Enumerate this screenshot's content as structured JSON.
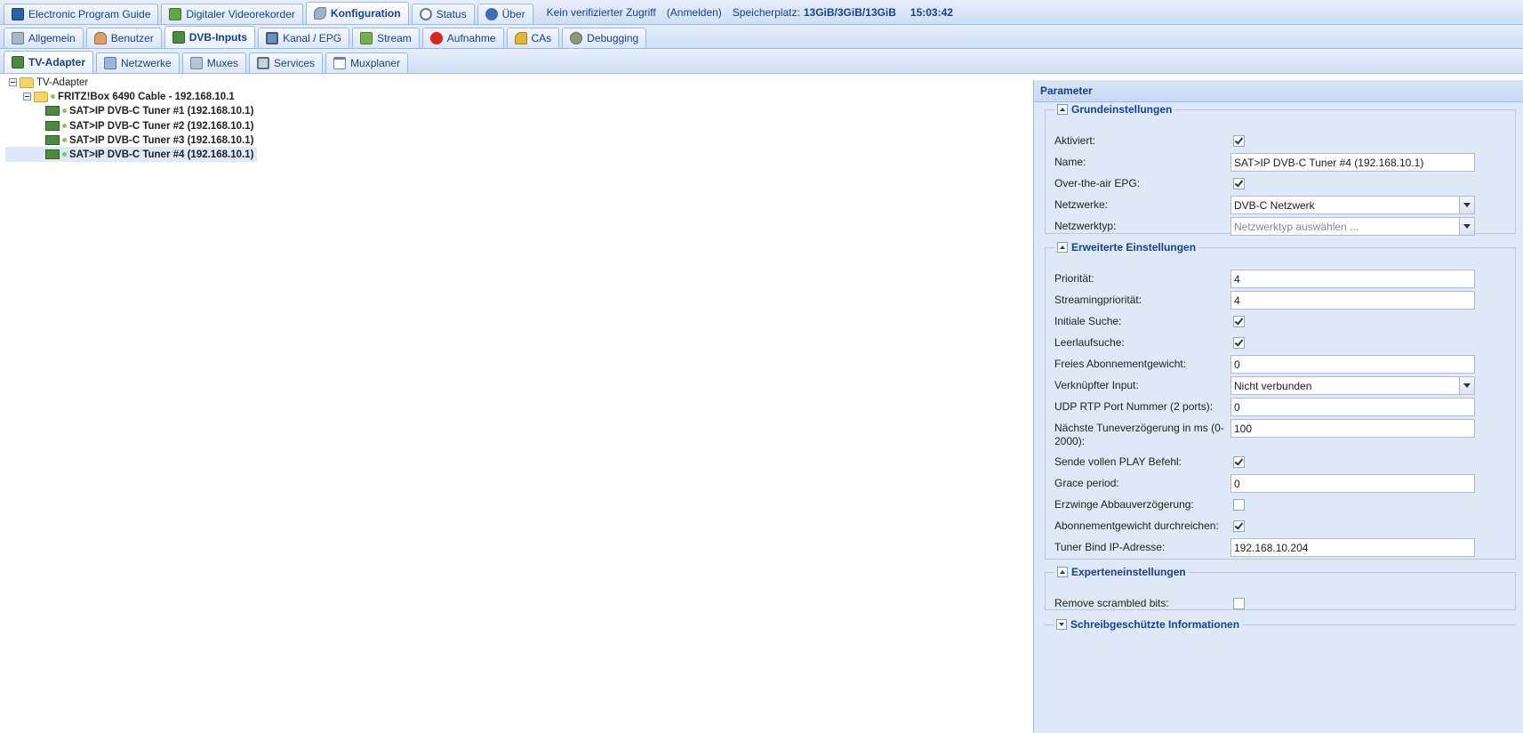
{
  "topbar": {
    "tabs": [
      {
        "label": "Electronic Program Guide",
        "icon": "epg-icon"
      },
      {
        "label": "Digitaler Videorekorder",
        "icon": "recorder-download-icon"
      },
      {
        "label": "Konfiguration",
        "icon": "wrench-icon",
        "active": true
      },
      {
        "label": "Status",
        "icon": "eye-icon"
      },
      {
        "label": "Über",
        "icon": "info-icon"
      }
    ],
    "access_text": "Kein verifizierter Zugriff",
    "login_link": "(Anmelden)",
    "storage_label": "Speicherplatz:",
    "storage_value": "13GiB/3GiB/13GiB",
    "clock": "15:03:42"
  },
  "config_tabs": [
    {
      "label": "Allgemein",
      "icon": "tools-icon"
    },
    {
      "label": "Benutzer",
      "icon": "users-icon"
    },
    {
      "label": "DVB-Inputs",
      "icon": "dvb-card-icon",
      "active": true
    },
    {
      "label": "Kanal / EPG",
      "icon": "tv-icon"
    },
    {
      "label": "Stream",
      "icon": "stream-icon"
    },
    {
      "label": "Aufnahme",
      "icon": "rec-icon"
    },
    {
      "label": "CAs",
      "icon": "key-icon"
    },
    {
      "label": "Debugging",
      "icon": "bug-icon"
    }
  ],
  "dvb_tabs": [
    {
      "label": "TV-Adapter",
      "icon": "tv-adapter-icon",
      "active": true
    },
    {
      "label": "Netzwerke",
      "icon": "antenna-icon"
    },
    {
      "label": "Muxes",
      "icon": "mux-icon"
    },
    {
      "label": "Services",
      "icon": "services-icon"
    },
    {
      "label": "Muxplaner",
      "icon": "calendar-icon"
    }
  ],
  "tree": {
    "root": "TV-Adapter",
    "device": "FRITZ!Box 6490 Cable - 192.168.10.1",
    "tuners": [
      "SAT>IP DVB-C Tuner #1 (192.168.10.1)",
      "SAT>IP DVB-C Tuner #2 (192.168.10.1)",
      "SAT>IP DVB-C Tuner #3 (192.168.10.1)",
      "SAT>IP DVB-C Tuner #4 (192.168.10.1)"
    ]
  },
  "panel": {
    "title": "Parameter",
    "basic": {
      "legend": "Grundeinstellungen",
      "aktiviert_label": "Aktiviert:",
      "aktiviert": true,
      "name_label": "Name:",
      "name_value": "SAT>IP DVB-C Tuner #4 (192.168.10.1)",
      "epg_label": "Over-the-air EPG:",
      "epg": true,
      "netzwerke_label": "Netzwerke:",
      "netzwerke_value": "DVB-C Netzwerk",
      "netzwerktyp_label": "Netzwerktyp:",
      "netzwerktyp_placeholder": "Netzwerktyp auswählen ..."
    },
    "advanced": {
      "legend": "Erweiterte Einstellungen",
      "prio_label": "Priorität:",
      "prio_value": "4",
      "stream_prio_label": "Streamingpriorität:",
      "stream_prio_value": "4",
      "initial_label": "Initiale Suche:",
      "initial": true,
      "idle_label": "Leerlaufsuche:",
      "idle": true,
      "free_weight_label": "Freies Abonnementgewicht:",
      "free_weight_value": "0",
      "linked_label": "Verknüpfter Input:",
      "linked_value": "Nicht verbunden",
      "udp_label": "UDP RTP Port Nummer (2 ports):",
      "udp_value": "0",
      "tune_delay_label": "Nächste Tuneverzögerung in ms (0-2000):",
      "tune_delay_value": "100",
      "play_label": "Sende vollen PLAY Befehl:",
      "play": true,
      "grace_label": "Grace period:",
      "grace_value": "0",
      "teardown_label": "Erzwinge Abbauverzögerung:",
      "teardown": false,
      "passthrough_label": "Abonnementgewicht durchreichen:",
      "passthrough": true,
      "bind_label": "Tuner Bind IP-Adresse:",
      "bind_value": "192.168.10.204"
    },
    "expert": {
      "legend": "Experteneinstellungen",
      "scrambled_label": "Remove scrambled bits:",
      "scrambled": false
    },
    "readonly": {
      "legend": "Schreibgeschützte Informationen"
    }
  },
  "colors": {
    "accent": "#15428b",
    "panel_bg": "#dfe8f6",
    "border": "#99bbe8"
  }
}
